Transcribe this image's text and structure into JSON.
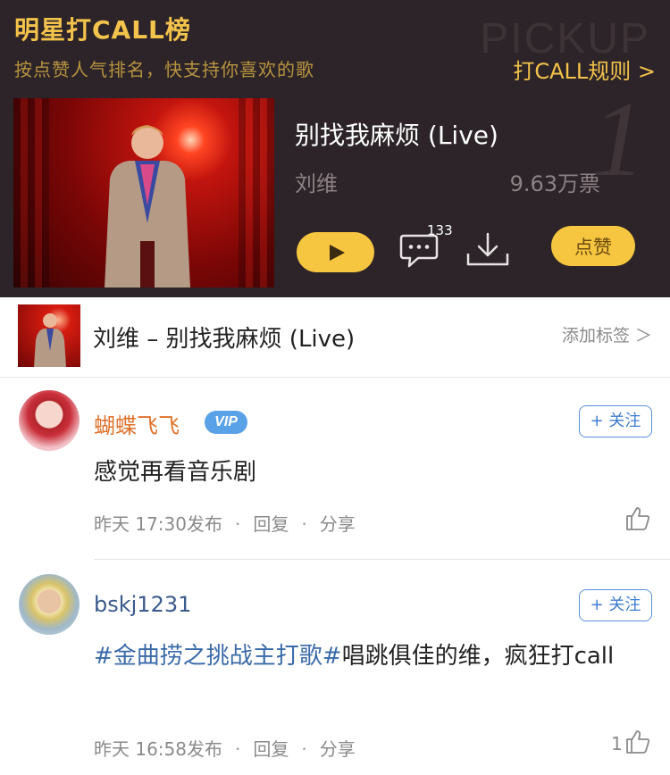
{
  "header": {
    "title": "明星打CALL榜",
    "subtitle": "按点赞人气排名，快支持你喜欢的歌",
    "watermark": "PICKUP",
    "rules_link": "打CALL规则 >",
    "song": {
      "title": "别找我麻烦 (Live)",
      "artist": "刘维",
      "votes": "9.63万票",
      "rank": "1",
      "comment_count": "133",
      "like_label": "点赞"
    },
    "colors": {
      "background": "#2c2428",
      "accent": "#f7c640"
    }
  },
  "strip": {
    "title": "刘维 – 别找我麻烦 (Live)",
    "tag_label": "添加标签 ＞"
  },
  "comments": [
    {
      "user": "蝴蝶飞飞",
      "vip_badge": "VIP",
      "follow_label": "+ 关注",
      "text": "感觉再看音乐剧",
      "time": "昨天 17:30发布",
      "reply": "回复",
      "share": "分享"
    },
    {
      "user": "bskj1231",
      "follow_label": "+ 关注",
      "hashtag": "#金曲捞之挑战主打歌#",
      "text": "唱跳俱佳的维，疯狂打call",
      "time": "昨天 16:58发布",
      "reply": "回复",
      "share": "分享",
      "likes": "1"
    }
  ],
  "separator": "·"
}
